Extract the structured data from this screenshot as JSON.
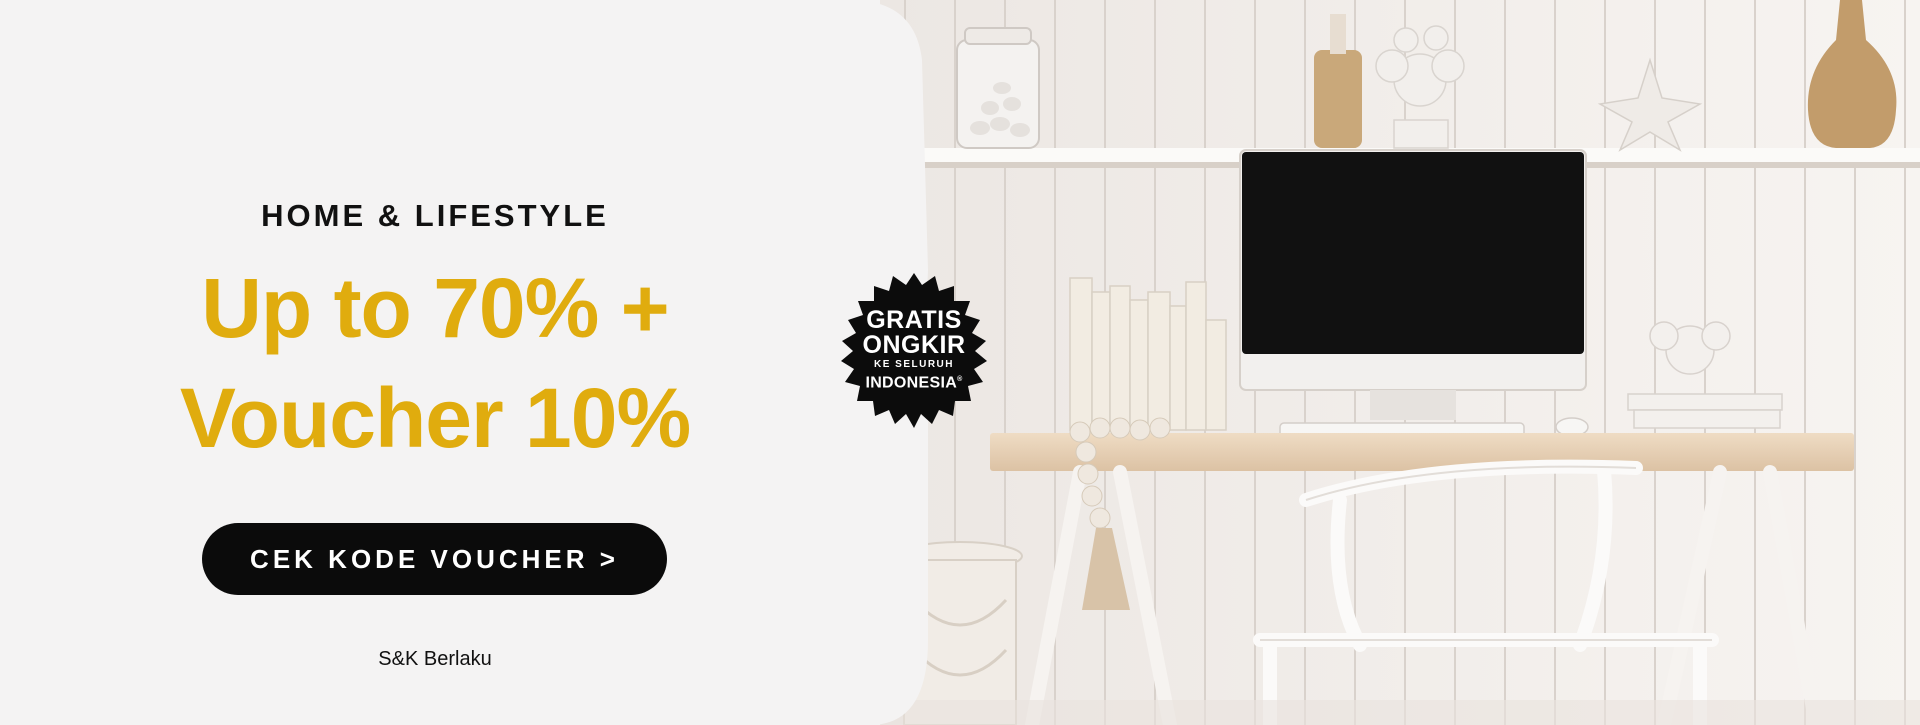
{
  "banner": {
    "category": "HOME & LIFESTYLE",
    "headline_line1": "Up to 70% +",
    "headline_line2": "Voucher 10%",
    "cta_label": "CEK KODE VOUCHER >",
    "terms": "S&K Berlaku",
    "accent_color": "#e0ac0e",
    "button_color": "#0b0b0b"
  },
  "badge": {
    "line1": "GRATIS",
    "line2": "ONGKIR",
    "line3": "KE SELURUH",
    "line4": "INDONESIA",
    "mark": "®"
  },
  "icons": [
    "starburst-badge-icon"
  ]
}
